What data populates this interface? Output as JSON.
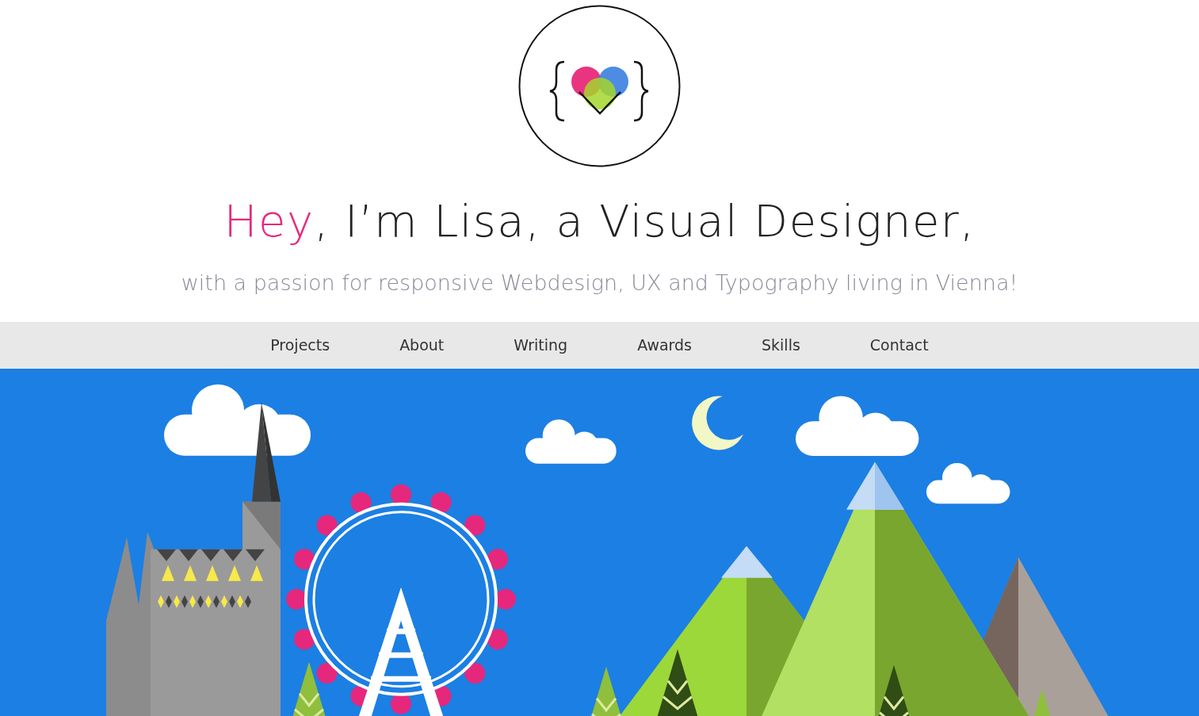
{
  "headline": {
    "accent": "Hey",
    "rest": ", I’m Lisa, a Visual Designer,"
  },
  "tagline": "with a passion for responsive Webdesign, UX and Typography living in Vienna!",
  "nav": [
    {
      "label": "Projects"
    },
    {
      "label": "About"
    },
    {
      "label": "Writing"
    },
    {
      "label": "Awards"
    },
    {
      "label": "Skills"
    },
    {
      "label": "Contact"
    }
  ]
}
